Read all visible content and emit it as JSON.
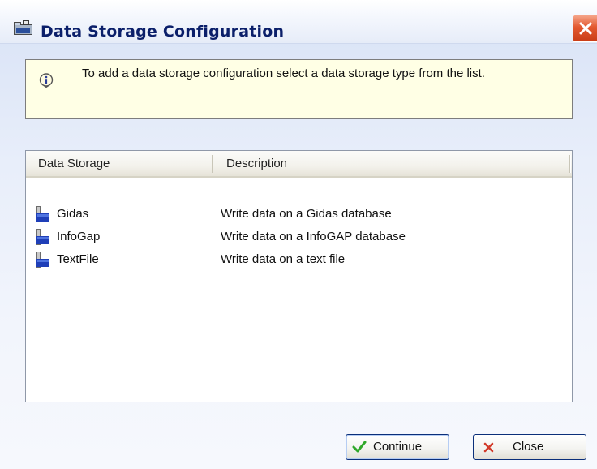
{
  "window": {
    "title": "Data Storage Configuration",
    "title_icon": "folder-settings-icon",
    "close_icon": "close-icon"
  },
  "info": {
    "icon": "info-icon",
    "message": "To add a data storage configuration select a data storage type from the list."
  },
  "list": {
    "columns": [
      "Data Storage",
      "Description"
    ],
    "rows": [
      {
        "name": "Gidas",
        "description": "Write data on a Gidas database",
        "icon": "data-storage-icon"
      },
      {
        "name": "InfoGap",
        "description": "Write data on a InfoGAP database",
        "icon": "data-storage-icon"
      },
      {
        "name": "TextFile",
        "description": "Write data on a text file",
        "icon": "data-storage-icon"
      }
    ]
  },
  "buttons": {
    "continue_label": "Continue",
    "continue_icon": "checkmark-icon",
    "close_label": "Close",
    "close_icon": "x-icon"
  },
  "colors": {
    "title_text": "#0b1f6a",
    "close_button": "#e3582f",
    "info_background": "#ffffe5",
    "checkmark": "#2fa82a",
    "x_mark": "#d23a2a"
  }
}
